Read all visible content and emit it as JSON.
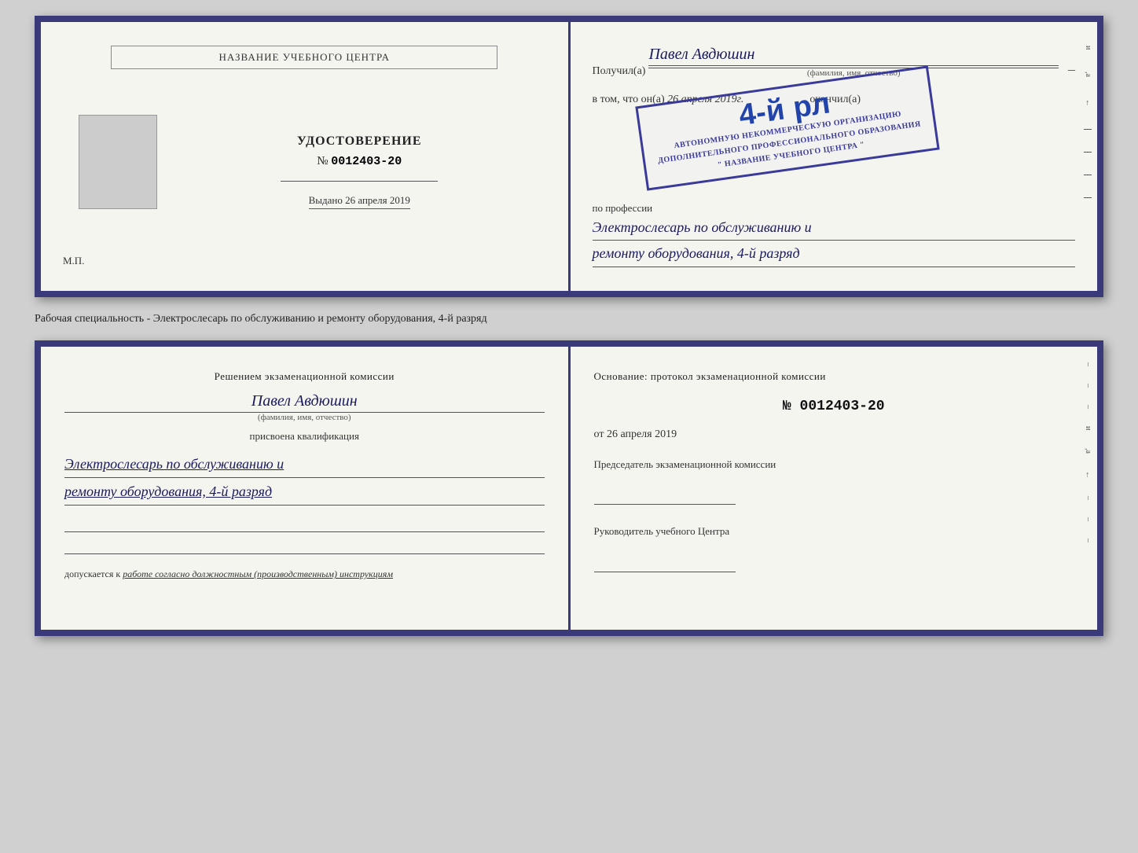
{
  "doc1": {
    "left": {
      "title": "НАЗВАНИЕ УЧЕБНОГО ЦЕНТРА",
      "cert_label": "УДОСТОВЕРЕНИЕ",
      "cert_number_prefix": "№",
      "cert_number": "0012403-20",
      "issued_label": "Выдано",
      "issued_date": "26 апреля 2019",
      "mp_label": "М.П."
    },
    "right": {
      "received_label": "Получил(а)",
      "full_name": "Павел Авдюшин",
      "fio_subtitle": "(фамилия, имя, отчество)",
      "vtom_label": "в том, что он(а)",
      "date_label": "26 апреля 2019г.",
      "okonchil_label": "окончил(а)",
      "stamp_line1": "АВТОНОМНУЮ НЕКОММЕРЧЕСКУЮ ОРГАНИЗАЦИЮ",
      "stamp_line2": "ДОПОЛНИТЕЛЬНОГО ПРОФЕССИОНАЛЬНОГО ОБРАЗОВАНИЯ",
      "stamp_line3": "\" НАЗВАНИЕ УЧЕБНОГО ЦЕНТРА \"",
      "stamp_grade": "4-й рл",
      "profession_label": "по профессии",
      "profession_line1": "Электрослесарь по обслуживанию и",
      "profession_line2": "ремонту оборудования, 4-й разряд"
    }
  },
  "caption": {
    "text": "Рабочая специальность - Электрослесарь по обслуживанию и ремонту оборудования, 4-й разряд"
  },
  "doc2": {
    "left": {
      "decision_label": "Решением экзаменационной комиссии",
      "person_name": "Павел Авдюшин",
      "fio_subtitle": "(фамилия, имя, отчество)",
      "assigned_label": "присвоена квалификация",
      "qualification_line1": "Электрослесарь по обслуживанию и",
      "qualification_line2": "ремонту оборудования, 4-й разряд",
      "допускается_label": "допускается к",
      "допускается_value": "работе согласно должностным (производственным) инструкциям"
    },
    "right": {
      "basis_label": "Основание: протокол экзаменационной комиссии",
      "protocol_prefix": "№",
      "protocol_number": "0012403-20",
      "from_prefix": "от",
      "from_date": "26 апреля 2019",
      "chairman_label": "Председатель экзаменационной комиссии",
      "head_label": "Руководитель учебного Центра"
    }
  },
  "colors": {
    "border": "#3a3a7a",
    "name_color": "#1a1a5e",
    "stamp_color": "#3a3a9a",
    "background": "#f5f5f0"
  }
}
